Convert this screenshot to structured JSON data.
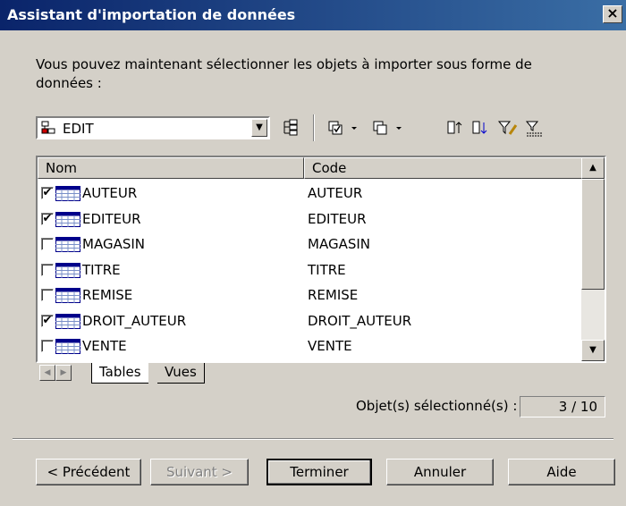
{
  "window": {
    "title": "Assistant d'importation de données",
    "close_label": "×"
  },
  "instruction": "Vous pouvez maintenant sélectionner les objets à importer sous forme de données :",
  "model_selector": {
    "value": "EDIT",
    "icon": "model-icon"
  },
  "toolbar": {
    "icons": [
      "hierarchy-icon",
      "select-all-icon",
      "deselect-all-icon",
      "sort-ascending-icon",
      "sort-descending-icon",
      "filter-edit-icon",
      "filter-icon"
    ]
  },
  "columns": {
    "name": "Nom",
    "code": "Code"
  },
  "rows": [
    {
      "name": "AUTEUR",
      "code": "AUTEUR",
      "checked": true
    },
    {
      "name": "EDITEUR",
      "code": "EDITEUR",
      "checked": true
    },
    {
      "name": "MAGASIN",
      "code": "MAGASIN",
      "checked": false
    },
    {
      "name": "TITRE",
      "code": "TITRE",
      "checked": false
    },
    {
      "name": "REMISE",
      "code": "REMISE",
      "checked": false
    },
    {
      "name": "DROIT_AUTEUR",
      "code": "DROIT_AUTEUR",
      "checked": true
    },
    {
      "name": "VENTE",
      "code": "VENTE",
      "checked": false
    }
  ],
  "tabs": {
    "tables": "Tables",
    "views": "Vues"
  },
  "selection": {
    "label": "Objet(s) sélectionné(s) :",
    "value": "3 / 10"
  },
  "buttons": {
    "previous": "< Précédent",
    "next": "Suivant >",
    "finish": "Terminer",
    "cancel": "Annuler",
    "help": "Aide"
  },
  "colors": {
    "titlebar_start": "#0a246a",
    "titlebar_end": "#3a6ea5",
    "face": "#d4d0c8"
  }
}
